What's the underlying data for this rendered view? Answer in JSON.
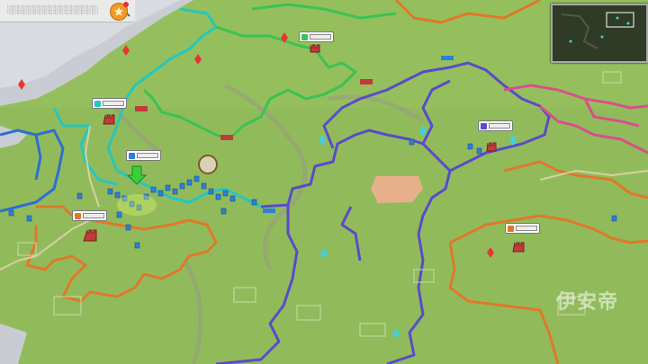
{
  "top_bar": {
    "search_placeholder": "░░░░░░░░░░░░░░░░░",
    "search_icon": "search-icon",
    "favorites_icon": "star-icon"
  },
  "minimap": {
    "icon": "minimap"
  },
  "watermark": {
    "text": "伊安帝"
  },
  "colors": {
    "grass": "#8fb95a",
    "territory_purple": "#5a4bc9",
    "territory_orange": "#e0782a",
    "territory_teal": "#27c6bd",
    "territory_green": "#3bc254",
    "territory_pink": "#d8508a",
    "territory_blue": "#2e6fd1",
    "unit_blue": "#2d7fd8",
    "castle_red": "#c23a3a",
    "selection_green": "#38d03a"
  },
  "player_markers": [
    {
      "id": "orange-1",
      "emblem": "shield-icon"
    },
    {
      "id": "teal-1",
      "emblem": "shield-icon"
    },
    {
      "id": "green-1",
      "emblem": "shield-icon"
    },
    {
      "id": "purple-1",
      "emblem": "shield-icon"
    },
    {
      "id": "orange-2",
      "emblem": "shield-icon"
    },
    {
      "id": "blue-army",
      "emblem": "sword-icon"
    }
  ]
}
